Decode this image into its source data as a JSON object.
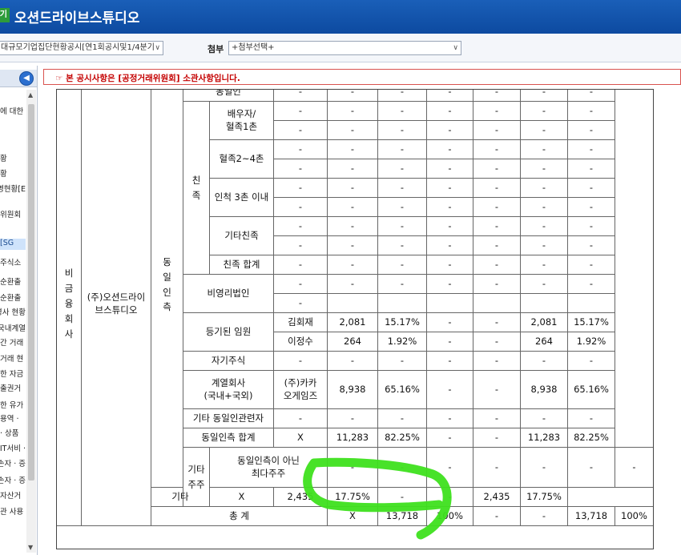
{
  "window": {
    "icon_label": "기",
    "title": "오션드라이브스튜디오"
  },
  "toolbar": {
    "report_value": "대규모기업집단현황공시[연1회공시및1/4분기",
    "attach_label": "첨부",
    "attach_value": "+첨부선택+"
  },
  "sidebar": {
    "collapse_icon": "chevron-left-icon",
    "items": [
      "에 대한",
      "황",
      "황",
      "영현황[E",
      "위원회",
      "SG]",
      "주식소",
      "순환출",
      "순환출",
      "영사 현황",
      "국내계열",
      "간 거래",
      "거래 현",
      "한 자금",
      "출권거",
      "한 유가",
      "· 용역",
      "상품 ·",
      "· IT서비",
      "손자 · 증",
      "손자 · 증",
      "자산거",
      "관 사용"
    ]
  },
  "notice": {
    "text": "☞ 본 공시사항은 [공정거래위원회] 소관사항입니다."
  },
  "table": {
    "group_col": "비금융회사",
    "company_col": "(주)오션드라이브스튜디오",
    "related_col": "동일인측",
    "kin_col": "친족",
    "other_shareholders_col": "기타주주",
    "dash": "-",
    "rows": {
      "same_person": {
        "label": "동일인",
        "name": "-",
        "v": [
          "-",
          "-",
          "-",
          "-",
          "-",
          "-",
          "-"
        ]
      },
      "spouse": {
        "label": "배우자/혈족1촌",
        "r1": [
          "-",
          "-",
          "-",
          "-",
          "-",
          "-",
          "-",
          "-"
        ],
        "r2": [
          "-",
          "-",
          "-",
          "-",
          "-",
          "-",
          "-",
          "-"
        ]
      },
      "blood": {
        "label": "혈족2~4촌",
        "r1": [
          "-",
          "-",
          "-",
          "-",
          "-",
          "-",
          "-",
          "-"
        ],
        "r2": [
          "-",
          "-",
          "-",
          "-",
          "-",
          "-",
          "-",
          "-"
        ]
      },
      "inlaw": {
        "label": "인척 3촌 이내",
        "r1": [
          "-",
          "-",
          "-",
          "-",
          "-",
          "-",
          "-",
          "-"
        ],
        "r2": [
          "-",
          "-",
          "-",
          "-",
          "-",
          "-",
          "-",
          "-"
        ]
      },
      "other_kin": {
        "label": "기타친족",
        "r1": [
          "-",
          "-",
          "-",
          "-",
          "-",
          "-",
          "-",
          "-"
        ],
        "r2": [
          "-",
          "-",
          "-",
          "-",
          "-",
          "-",
          "-",
          "-"
        ]
      },
      "kin_total": {
        "label": "친족 합계",
        "v": [
          "-",
          "-",
          "-",
          "-",
          "-",
          "-",
          "-",
          "-"
        ]
      },
      "nonprofit": {
        "label": "비영리법인",
        "r1": [
          "-",
          "-",
          "-",
          "-",
          "-",
          "-",
          "-",
          "-"
        ],
        "r2": [
          "-"
        ]
      },
      "officers": {
        "label": "등기된 임원",
        "r1": [
          "김회재",
          "2,081",
          "15.17%",
          "-",
          "-",
          "2,081",
          "15.17%"
        ],
        "r2": [
          "이정수",
          "264",
          "1.92%",
          "-",
          "-",
          "264",
          "1.92%"
        ]
      },
      "treasury": {
        "label": "자기주식",
        "v": [
          "-",
          "-",
          "-",
          "-",
          "-",
          "-",
          "-",
          "-"
        ]
      },
      "affiliates": {
        "label": "계열회사(국내+국외)",
        "v": [
          "(주)카카오게임즈",
          "8,938",
          "65.16%",
          "-",
          "-",
          "8,938",
          "65.16%"
        ]
      },
      "other_related": {
        "label": "기타 동일인관련자",
        "v": [
          "-",
          "-",
          "-",
          "-",
          "-",
          "-",
          "-",
          "-"
        ]
      },
      "related_total": {
        "label": "동일인측 합계",
        "v": [
          "X",
          "11,283",
          "82.25%",
          "-",
          "-",
          "11,283",
          "82.25%"
        ]
      },
      "largest_nonrelated": {
        "label": "동일인측이 아닌 최다주주",
        "v": [
          "-",
          "-",
          "-",
          "-",
          "-",
          "-",
          "-"
        ]
      },
      "others": {
        "label": "기타",
        "v": [
          "X",
          "2,435",
          "17.75%",
          "-",
          "-",
          "2,435",
          "17.75%"
        ]
      },
      "grand_total": {
        "label": "총 계",
        "v": [
          "X",
          "13,718",
          "100%",
          "-",
          "-",
          "13,718",
          "100%"
        ]
      }
    }
  },
  "annotation": {
    "color": "#3ee01d"
  }
}
